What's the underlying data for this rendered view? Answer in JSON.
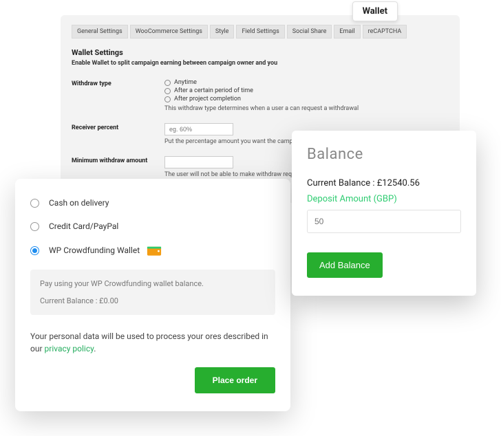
{
  "tooltip": {
    "label": "Wallet"
  },
  "settings": {
    "tabs": [
      "General Settings",
      "WooCommerce Settings",
      "Style",
      "Field Settings",
      "Social Share",
      "Email",
      "reCAPTCHA"
    ],
    "heading": "Wallet Settings",
    "subheading": "Enable Wallet to split campaign earning between campaign owner and you",
    "withdraw": {
      "label": "Withdraw type",
      "options": [
        "Anytime",
        "After a certain period of time",
        "After project completion"
      ],
      "help": "This withdraw type determines when a user a can request a withdrawal"
    },
    "receiver": {
      "label": "Receiver percent",
      "placeholder": "eg. 60%",
      "help": "Put the percentage amount you want the campaign"
    },
    "minimum": {
      "label": "Minimum withdraw amount",
      "placeholder": "",
      "help": "The user will not be able to make withdraw request"
    }
  },
  "checkout": {
    "options": {
      "cod": "Cash on delivery",
      "card": "Credit Card/PayPal",
      "wallet": "WP Crowdfunding Wallet"
    },
    "infobox": {
      "line1": "Pay using your WP Crowdfunding wallet balance.",
      "line2": "Current Balance : £0.00"
    },
    "privacy_text": "Your personal data will be used to process your ores described in our ",
    "privacy_link": "privacy policy",
    "privacy_period": ".",
    "place_order": "Place order"
  },
  "balance": {
    "title": "Balance",
    "current": "Current Balance : £12540.56",
    "deposit_label": "Deposit Amount (GBP)",
    "deposit_placeholder": "50",
    "add_button": "Add Balance"
  }
}
